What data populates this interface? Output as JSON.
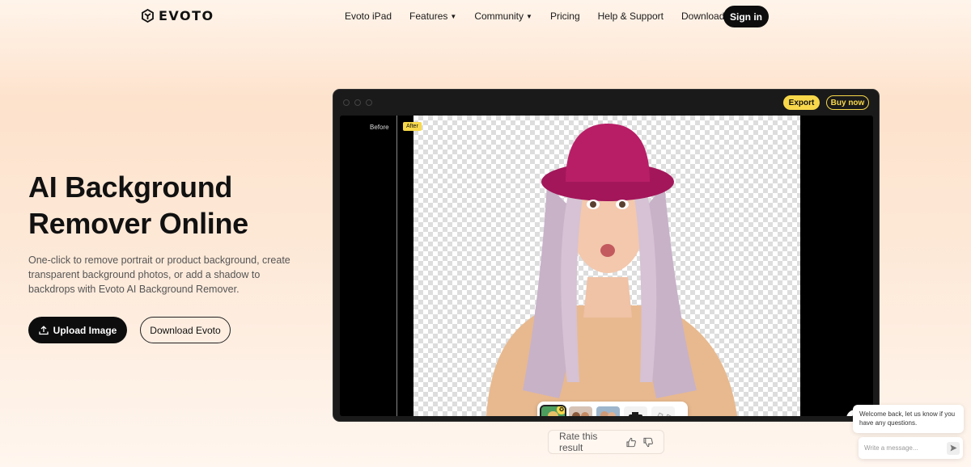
{
  "nav": {
    "logo_text": "EVOTO",
    "links": [
      {
        "label": "Evoto iPad",
        "has_caret": false
      },
      {
        "label": "Features",
        "has_caret": true
      },
      {
        "label": "Community",
        "has_caret": true
      },
      {
        "label": "Pricing",
        "has_caret": false
      },
      {
        "label": "Help & Support",
        "has_caret": false
      },
      {
        "label": "Download",
        "has_caret": false
      }
    ],
    "signin_label": "Sign in"
  },
  "hero": {
    "title": "AI Background Remover Online",
    "description": "One-click to remove portrait or product background, create transparent background photos, or add a shadow to backdrops with Evoto AI Background Remover.",
    "upload_label": "Upload Image",
    "download_label": "Download Evoto"
  },
  "app": {
    "export_label": "Export",
    "buynow_label": "Buy now",
    "before_label": "Before",
    "after_label": "After",
    "thumbnails": [
      "woman-portrait",
      "group-photo",
      "couple-photo",
      "camera-product",
      "shoes-product"
    ],
    "accent_color": "#f8d84a"
  },
  "rate": {
    "label": "Rate this result"
  },
  "chat": {
    "welcome": "Welcome back, let us know if you have any questions.",
    "placeholder": "Write a message..."
  }
}
